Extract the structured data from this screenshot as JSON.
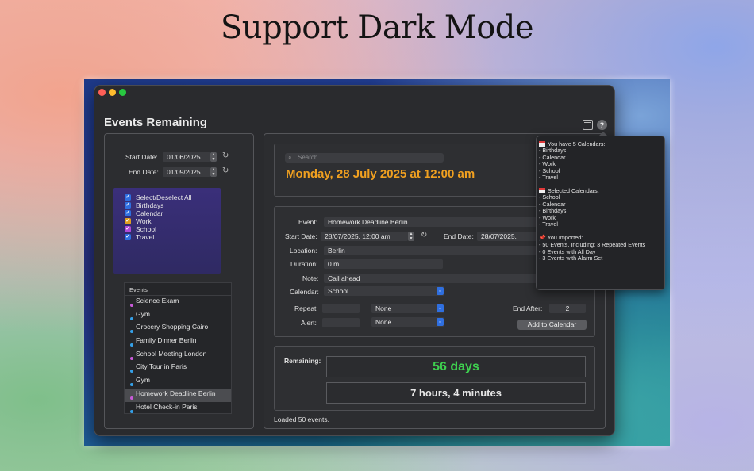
{
  "headline": "Support Dark Mode",
  "window": {
    "title": "Events Remaining"
  },
  "filters": {
    "start_label": "Start Date:",
    "start_value": "01/06/2025",
    "end_label": "End Date:",
    "end_value": "01/09/2025"
  },
  "calendars": [
    {
      "label": "Select/Deselect All",
      "color": "#2f6fe0"
    },
    {
      "label": "Birthdays",
      "color": "#2f6fe0"
    },
    {
      "label": "Calendar",
      "color": "#2f6fe0"
    },
    {
      "label": "Work",
      "color": "#e0a020"
    },
    {
      "label": "School",
      "color": "#b04ad8"
    },
    {
      "label": "Travel",
      "color": "#2f6fe0"
    }
  ],
  "events": {
    "header": "Events",
    "items": [
      {
        "name": "Science Exam",
        "color": "#c85ad8"
      },
      {
        "name": "Gym",
        "color": "#35a0e8"
      },
      {
        "name": "Grocery Shopping Cairo",
        "color": "#35a0e8"
      },
      {
        "name": "Family Dinner Berlin",
        "color": "#35a0e8"
      },
      {
        "name": "School Meeting London",
        "color": "#c85ad8"
      },
      {
        "name": "City Tour in Paris",
        "color": "#35a0e8"
      },
      {
        "name": "Gym",
        "color": "#35a0e8"
      },
      {
        "name": "Homework Deadline Berlin",
        "color": "#c85ad8",
        "selected": true
      },
      {
        "name": "Hotel Check-in Paris",
        "color": "#35a0e8"
      }
    ]
  },
  "search": {
    "placeholder": "Search"
  },
  "current_date": "Monday, 28 July 2025 at 12:00 am",
  "form": {
    "event_label": "Event:",
    "event_value": "Homework Deadline Berlin",
    "start_label": "Start Date:",
    "start_value": "28/07/2025, 12:00 am",
    "end_label": "End Date:",
    "end_value": "28/07/2025,",
    "location_label": "Location:",
    "location_value": "Berlin",
    "duration_label": "Duration:",
    "duration_value": "0 m",
    "note_label": "Note:",
    "note_value": "Call ahead",
    "calendar_label": "Calendar:",
    "calendar_value": "School",
    "repeat_label": "Repeat:",
    "repeat_value": "None",
    "alert_label": "Alert:",
    "alert_value": "None",
    "end_after_label": "End After:",
    "end_after_value": "2",
    "add_button": "Add to Calendar"
  },
  "remaining": {
    "label": "Remaining:",
    "days": "56 days",
    "hours": "7 hours, 4 minutes"
  },
  "status": "Loaded 50 events.",
  "popover": {
    "calendars_header": "You have 5 Calendars:",
    "calendars": [
      "- Birthdays",
      "- Calendar",
      "- Work",
      "- School",
      "- Travel"
    ],
    "selected_header": "Selected Calendars:",
    "selected": [
      "- School",
      "- Calendar",
      "- Birthdays",
      "- Work",
      "- Travel"
    ],
    "imported_header": "You Imported:",
    "imported": [
      "- 50 Events, Including: 3 Repeated Events",
      "- 0 Events with All Day",
      "- 3 Events with Alarm Set"
    ]
  },
  "icons": {
    "search": "search-icon",
    "refresh": "refresh-icon",
    "calendar": "calendar-icon",
    "help": "help-icon",
    "pin": "pin-icon"
  }
}
